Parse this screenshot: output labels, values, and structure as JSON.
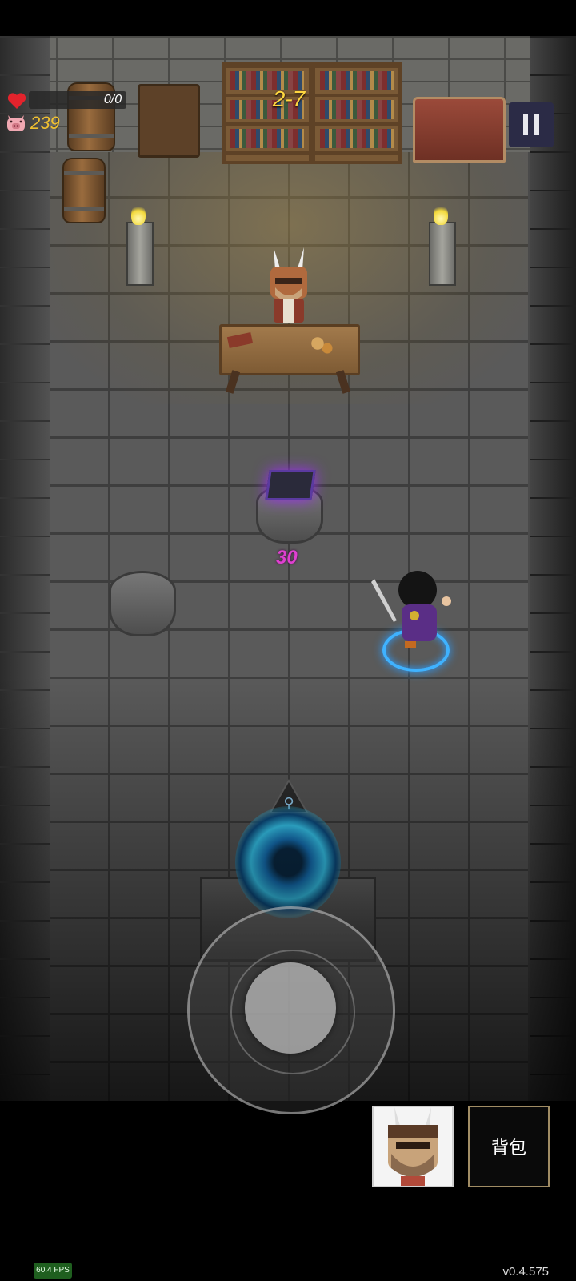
{
  "hud": {
    "health_text": "0/0",
    "gold": "239",
    "level": "2-7",
    "pause_label": "II"
  },
  "combat": {
    "damage_number": "30"
  },
  "controls": {
    "bag_label": "背包"
  },
  "debug": {
    "fps": "60.4 FPS",
    "version": "v0.4.575"
  },
  "colors": {
    "gold_text": "#f0c030",
    "level_text": "#ffd740",
    "damage_text": "#e040d0",
    "player_ring": "#3fb2ff",
    "portal": "#3ad5ff"
  },
  "icons": [
    "heart-icon",
    "pig-icon",
    "pause-icon"
  ]
}
